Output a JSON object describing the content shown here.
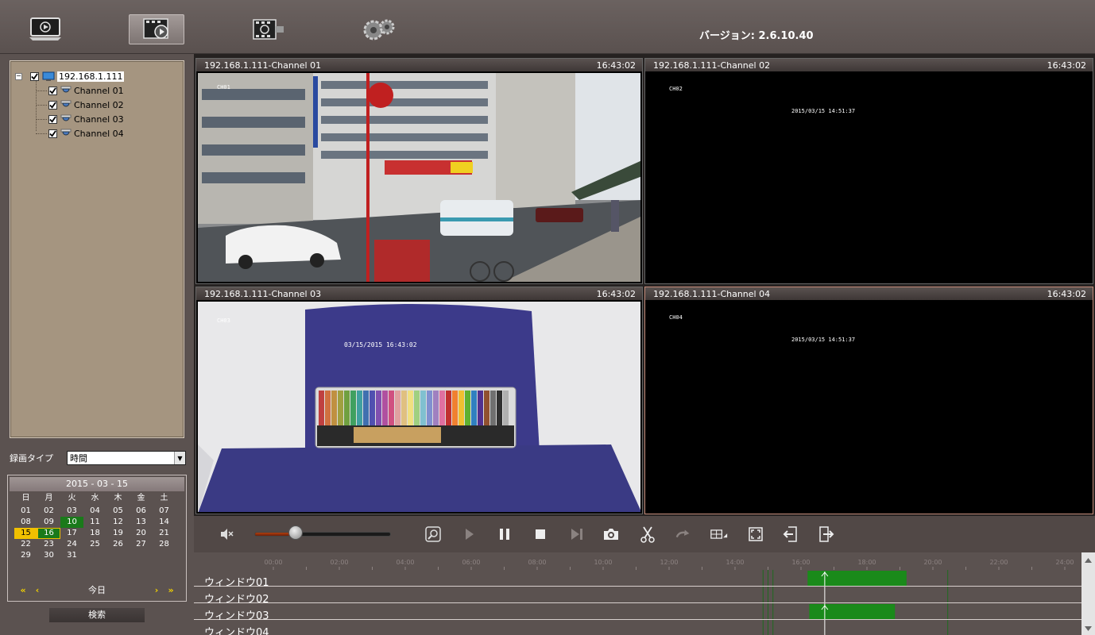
{
  "toolbar": {
    "buttons": [
      {
        "name": "live-view",
        "icon": "monitor-play-icon",
        "active": false
      },
      {
        "name": "playback",
        "icon": "film-play-icon",
        "active": true
      },
      {
        "name": "export",
        "icon": "film-export-icon",
        "active": false
      },
      {
        "name": "settings",
        "icon": "gears-icon",
        "active": false
      }
    ],
    "version": "バージョン: 2.6.10.40"
  },
  "tree": {
    "device": "192.168.1.111",
    "channels": [
      "Channel 01",
      "Channel 02",
      "Channel 03",
      "Channel 04"
    ]
  },
  "record_type": {
    "label": "録画タイプ",
    "value": "時間"
  },
  "calendar": {
    "header": "2015 - 03 - 15",
    "weekdays": [
      "日",
      "月",
      "火",
      "水",
      "木",
      "金",
      "土"
    ],
    "days": [
      "01",
      "02",
      "03",
      "04",
      "05",
      "06",
      "07",
      "08",
      "09",
      "10",
      "11",
      "12",
      "13",
      "14",
      "15",
      "16",
      "17",
      "18",
      "19",
      "20",
      "21",
      "22",
      "23",
      "24",
      "25",
      "26",
      "27",
      "28",
      "29",
      "30",
      "31"
    ],
    "recorded_days": [
      "10",
      "16"
    ],
    "selected_day": "15",
    "prev_year": "«",
    "prev_month": "‹",
    "today": "今日",
    "next_month": "›",
    "next_year": "»"
  },
  "search_label": "検索",
  "panes": [
    {
      "title": "192.168.1.111-Channel 01",
      "time": "16:43:02",
      "osd_name": "CH01",
      "osd_time": ""
    },
    {
      "title": "192.168.1.111-Channel 02",
      "time": "16:43:02",
      "osd_name": "CH02",
      "osd_time": "2015/03/15 14:51:37"
    },
    {
      "title": "192.168.1.111-Channel 03",
      "time": "16:43:02",
      "osd_name": "CH03",
      "osd_time": "03/15/2015 16:43:02"
    },
    {
      "title": "192.168.1.111-Channel 04",
      "time": "16:43:02",
      "osd_name": "CH04",
      "osd_time": "2015/03/15 14:51:37"
    }
  ],
  "controls": {
    "volume": 0.3,
    "buttons": [
      "mute-icon",
      "zoom-icon",
      "play-icon",
      "pause-icon",
      "stop-icon",
      "step-forward-icon",
      "snapshot-icon",
      "cut-icon",
      "redo-icon",
      "layout-icon",
      "fullscreen-icon",
      "import-icon",
      "export-icon"
    ]
  },
  "timeline": {
    "hours": [
      "00:00",
      "02:00",
      "04:00",
      "06:00",
      "08:00",
      "10:00",
      "12:00",
      "14:00",
      "16:00",
      "18:00",
      "20:00",
      "22:00",
      "24:00"
    ],
    "rows": [
      {
        "label": "ウィンドウ01",
        "segments": [
          [
            16.2,
            19.2
          ]
        ]
      },
      {
        "label": "ウィンドウ02",
        "segments": []
      },
      {
        "label": "ウィンドウ03",
        "segments": [
          [
            16.25,
            18.85
          ]
        ]
      },
      {
        "label": "ウィンドウ04",
        "segments": []
      }
    ],
    "cursor_hour": 16.72,
    "colors": {
      "segment": "#1a8a1a",
      "marker": "#1f6a1f"
    }
  }
}
